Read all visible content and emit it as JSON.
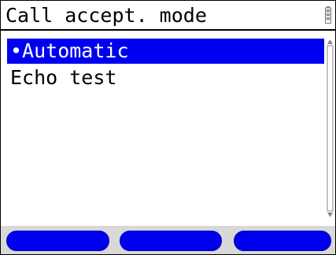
{
  "header": {
    "title": "Call accept. mode",
    "status_icon": "battery-icon"
  },
  "menu": {
    "items": [
      {
        "label": "•Automatic",
        "selected": true
      },
      {
        "label": "Echo test",
        "selected": false
      }
    ]
  },
  "softkeys": [
    {
      "label": ""
    },
    {
      "label": ""
    },
    {
      "label": ""
    }
  ],
  "colors": {
    "selection": "#0000f0",
    "softkey": "#0000f0",
    "bottom_bar": "#d8d8d8"
  }
}
